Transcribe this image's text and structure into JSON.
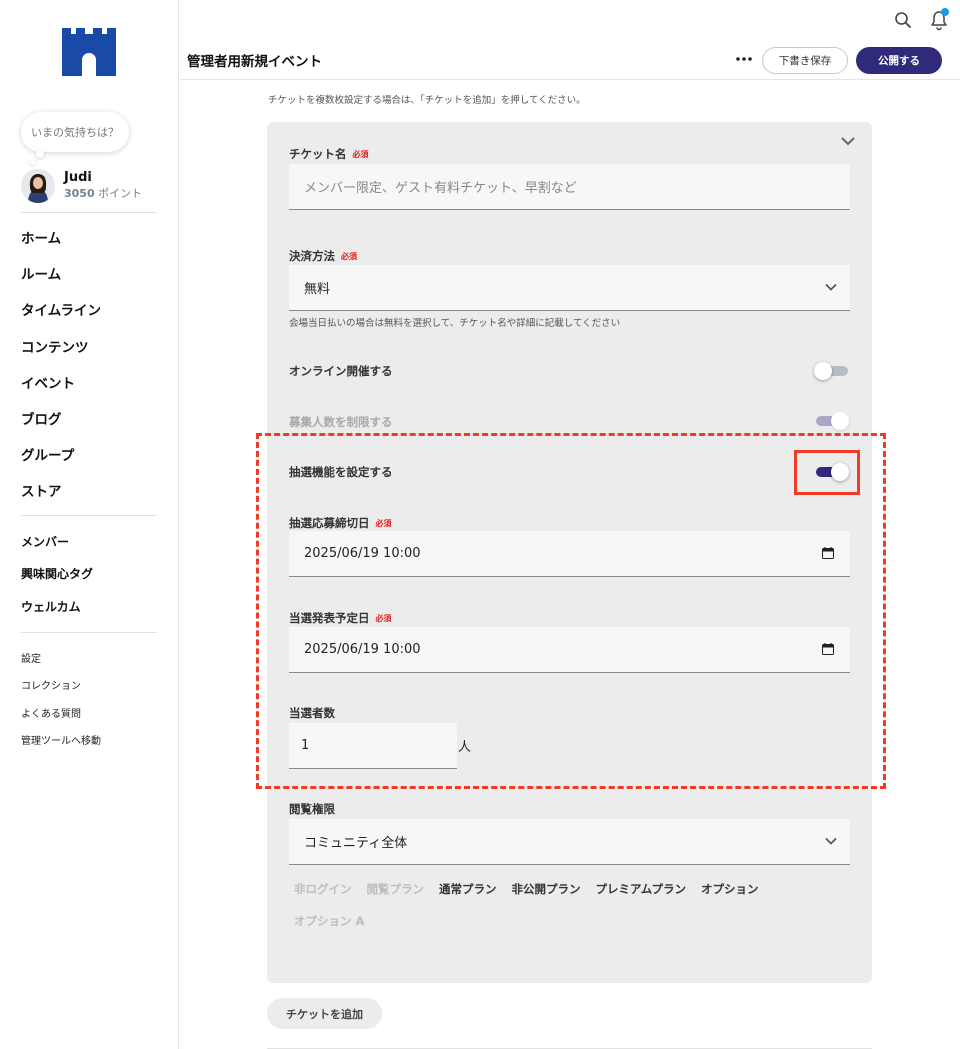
{
  "sidebar": {
    "mood_prompt": "いまの気持ちは？",
    "user": {
      "name": "Judi",
      "points": "3050",
      "points_unit": "ポイント"
    },
    "nav_main": [
      {
        "label": "ホーム"
      },
      {
        "label": "ルーム"
      },
      {
        "label": "タイムライン"
      },
      {
        "label": "コンテンツ"
      },
      {
        "label": "イベント"
      },
      {
        "label": "ブログ"
      },
      {
        "label": "グループ"
      },
      {
        "label": "ストア"
      }
    ],
    "nav_sub": [
      {
        "label": "メンバー"
      },
      {
        "label": "興味関心タグ"
      },
      {
        "label": "ウェルカム"
      }
    ],
    "nav_small": [
      {
        "label": "設定"
      },
      {
        "label": "コレクション"
      },
      {
        "label": "よくある質問"
      },
      {
        "label": "管理ツールへ移動"
      }
    ],
    "brand_color": "#1a4aa8"
  },
  "header": {
    "title": "管理者用新規イベント",
    "draft_label": "下書き保存",
    "publish_label": "公開する",
    "icons": [
      "search-icon",
      "bell-icon",
      "more-icon"
    ],
    "accent": "#2f2b7a"
  },
  "form": {
    "top_hint": "チケットを複数枚設定する場合は、「チケットを追加」を押してください。",
    "required_tag": "必須",
    "ticket_name": {
      "label": "チケット名",
      "placeholder": "メンバー限定、ゲスト有料チケット、早割など"
    },
    "payment": {
      "label": "決済方法",
      "value": "無料",
      "hint": "会場当日払いの場合は無料を選択して、チケット名や詳細に記載してください"
    },
    "online": {
      "label": "オンライン開催する",
      "on": false
    },
    "capacity": {
      "label": "募集人数を制限する",
      "on": true,
      "disabled": true
    },
    "lottery": {
      "label": "抽選機能を設定する",
      "on": true
    },
    "lottery_deadline": {
      "label": "抽選応募締切日",
      "value": "2025/06/19 10:00"
    },
    "announce_date": {
      "label": "当選発表予定日",
      "value": "2025/06/19 10:00"
    },
    "winners": {
      "label": "当選者数",
      "value": "1",
      "unit": "人"
    },
    "visibility": {
      "label": "閲覧権限",
      "value": "コミュニティ全体",
      "plans_row1": [
        {
          "label": "非ログイン",
          "active": false
        },
        {
          "label": "閲覧プラン",
          "active": false
        },
        {
          "label": "通常プラン",
          "active": true
        },
        {
          "label": "非公開プラン",
          "active": true
        },
        {
          "label": "プレミアムプラン",
          "active": true
        },
        {
          "label": "オプション",
          "active": true
        }
      ],
      "plans_row2": [
        {
          "label": "オプション A",
          "active": false
        }
      ]
    },
    "add_ticket_label": "チケットを追加"
  },
  "colors": {
    "toggle_on": "#2f2b7a",
    "toggle_off": "#b7bcc5",
    "toggle_disabled": "#a9a6c7",
    "highlight": "#f03a26",
    "required": "#e0201b"
  }
}
